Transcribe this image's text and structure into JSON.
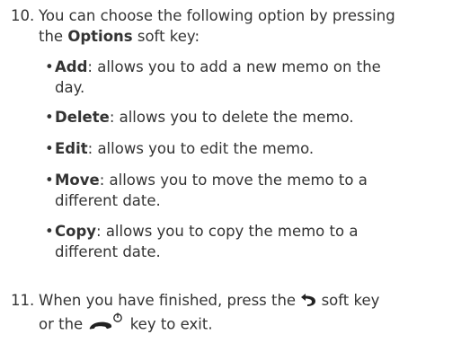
{
  "step10": {
    "number": "10.",
    "line1_pre": "You can choose the following option by pressing",
    "line2_pre": "the ",
    "options_bold": "Options",
    "line2_post": " soft key:"
  },
  "bullets": [
    {
      "term": "Add",
      "line1": ": allows you to add a new memo on the",
      "line2": "day."
    },
    {
      "term": "Delete",
      "line1": ": allows you to delete the memo.",
      "line2": ""
    },
    {
      "term": "Edit",
      "line1": ": allows you to edit the memo.",
      "line2": ""
    },
    {
      "term": "Move",
      "line1": ": allows you to move the memo to a",
      "line2": "different date."
    },
    {
      "term": "Copy",
      "line1": ": allows you to copy the memo to a",
      "line2": "different date."
    }
  ],
  "step11": {
    "number": "11.",
    "line1_pre": "When you have finished, press the ",
    "line1_post": " soft key",
    "line2_pre": "or the ",
    "line2_post": " key to exit."
  },
  "icons": {
    "back": "back-arrow-icon",
    "end_key": "end-call-power-icon"
  }
}
